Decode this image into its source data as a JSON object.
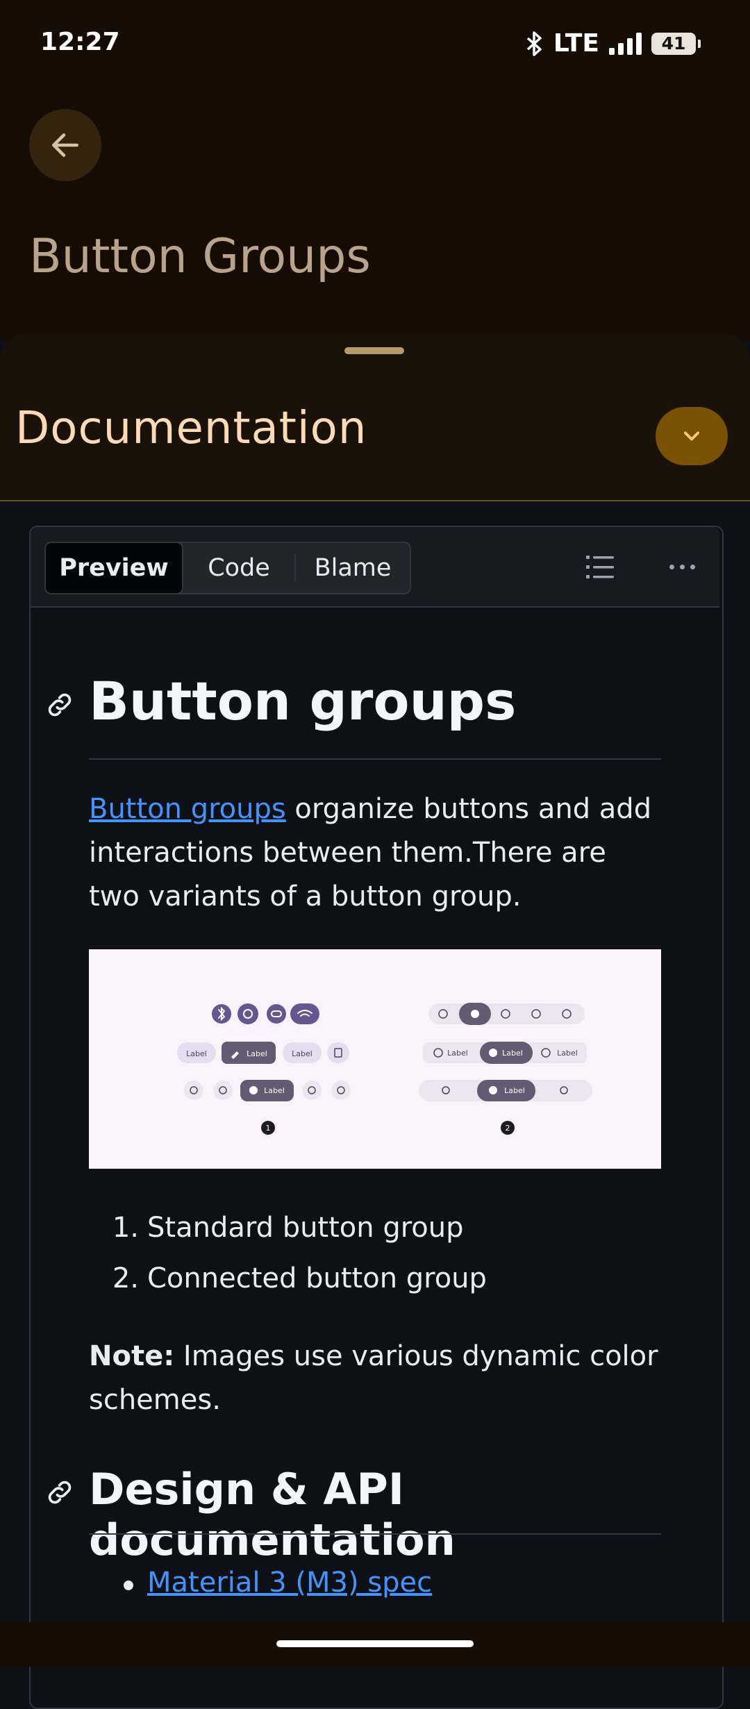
{
  "status_bar": {
    "time": "12:27",
    "network": "LTE",
    "battery": "41",
    "icons": [
      "bluetooth-icon",
      "signal-icon",
      "battery-icon"
    ]
  },
  "app_bar": {
    "back_icon": "arrow-left-icon",
    "title": "Button Groups"
  },
  "sheet": {
    "title": "Documentation",
    "collapse_icon": "chevron-down-icon",
    "accent": "#7a5206"
  },
  "file_view": {
    "tabs": [
      "Preview",
      "Code",
      "Blame"
    ],
    "active_tab": "Preview",
    "outline_icon": "list-icon",
    "more_icon": "more-horizontal-icon"
  },
  "doc": {
    "h1": "Button groups",
    "para_link": "Button groups",
    "para_text": " organize buttons and add interactions between them.There are two variants of a button group.",
    "image": {
      "labels": {
        "label": "Label",
        "badge1": "1",
        "badge2": "2"
      }
    },
    "list": [
      {
        "num": "1.",
        "text": "Standard button group"
      },
      {
        "num": "2.",
        "text": "Connected button group"
      }
    ],
    "note_label": "Note:",
    "note_text": " Images use various dynamic color schemes.",
    "h2": "Design & API documentation",
    "links": [
      "Material 3 (M3) spec"
    ],
    "link_color": "#4493f8"
  }
}
